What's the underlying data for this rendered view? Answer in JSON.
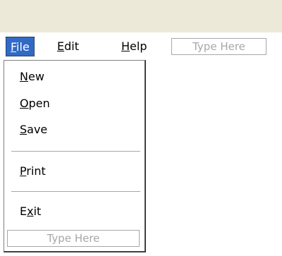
{
  "menubar": {
    "file": {
      "accel": "F",
      "rest": "ile"
    },
    "edit": {
      "accel": "E",
      "rest": "dit"
    },
    "help": {
      "accel": "H",
      "rest": "elp"
    },
    "type_here": "Type Here"
  },
  "file_menu": {
    "new": {
      "accel": "N",
      "rest": "ew"
    },
    "open": {
      "accel": "O",
      "rest": "pen"
    },
    "save": {
      "accel": "S",
      "rest": "ave"
    },
    "print": {
      "accel": "P",
      "rest": "rint"
    },
    "exit": {
      "pre": "E",
      "accel": "x",
      "rest": "it"
    },
    "type_here": "Type Here"
  },
  "colors": {
    "menu_highlight": "#316ac5",
    "placeholder_text": "#a7a6aa",
    "title_strip": "#ece9d8"
  }
}
